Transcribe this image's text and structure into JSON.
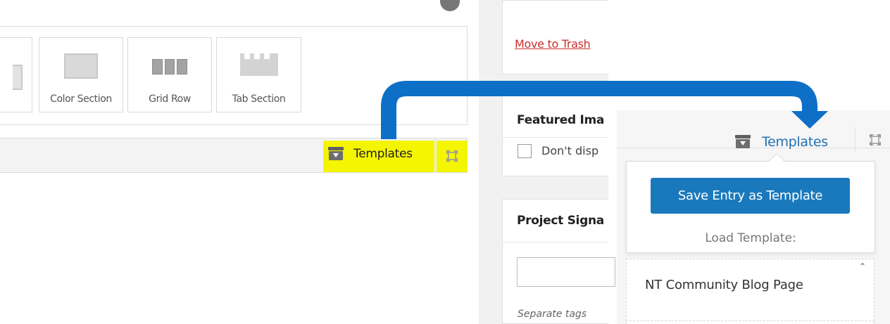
{
  "elements": {
    "color_section_label": "Color Section",
    "grid_row_label": "Grid Row",
    "tab_section_label": "Tab Section"
  },
  "toolbar": {
    "templates_label": "Templates",
    "highlight_color": "#f4f500"
  },
  "sidebar": {
    "trash_link": "Move to Trash",
    "featured_title": "Featured Ima",
    "checkbox_label": "Don't disp",
    "project_title": "Project Signa",
    "tags_hint": "Separate tags"
  },
  "zoom": {
    "templates_label": "Templates",
    "save_button_label": "Save Entry as Template",
    "load_label": "Load Template:",
    "templates": [
      "NT Community Blog Page"
    ]
  },
  "colors": {
    "accent_blue": "#1a79bd",
    "connector_blue": "#0d6fc6",
    "link_red": "#c9302c"
  },
  "icons": [
    "help-icon",
    "color-section-icon",
    "grid-row-icon",
    "tab-section-icon",
    "templates-box-icon",
    "fullscreen-icon",
    "scroll-up-icon"
  ]
}
